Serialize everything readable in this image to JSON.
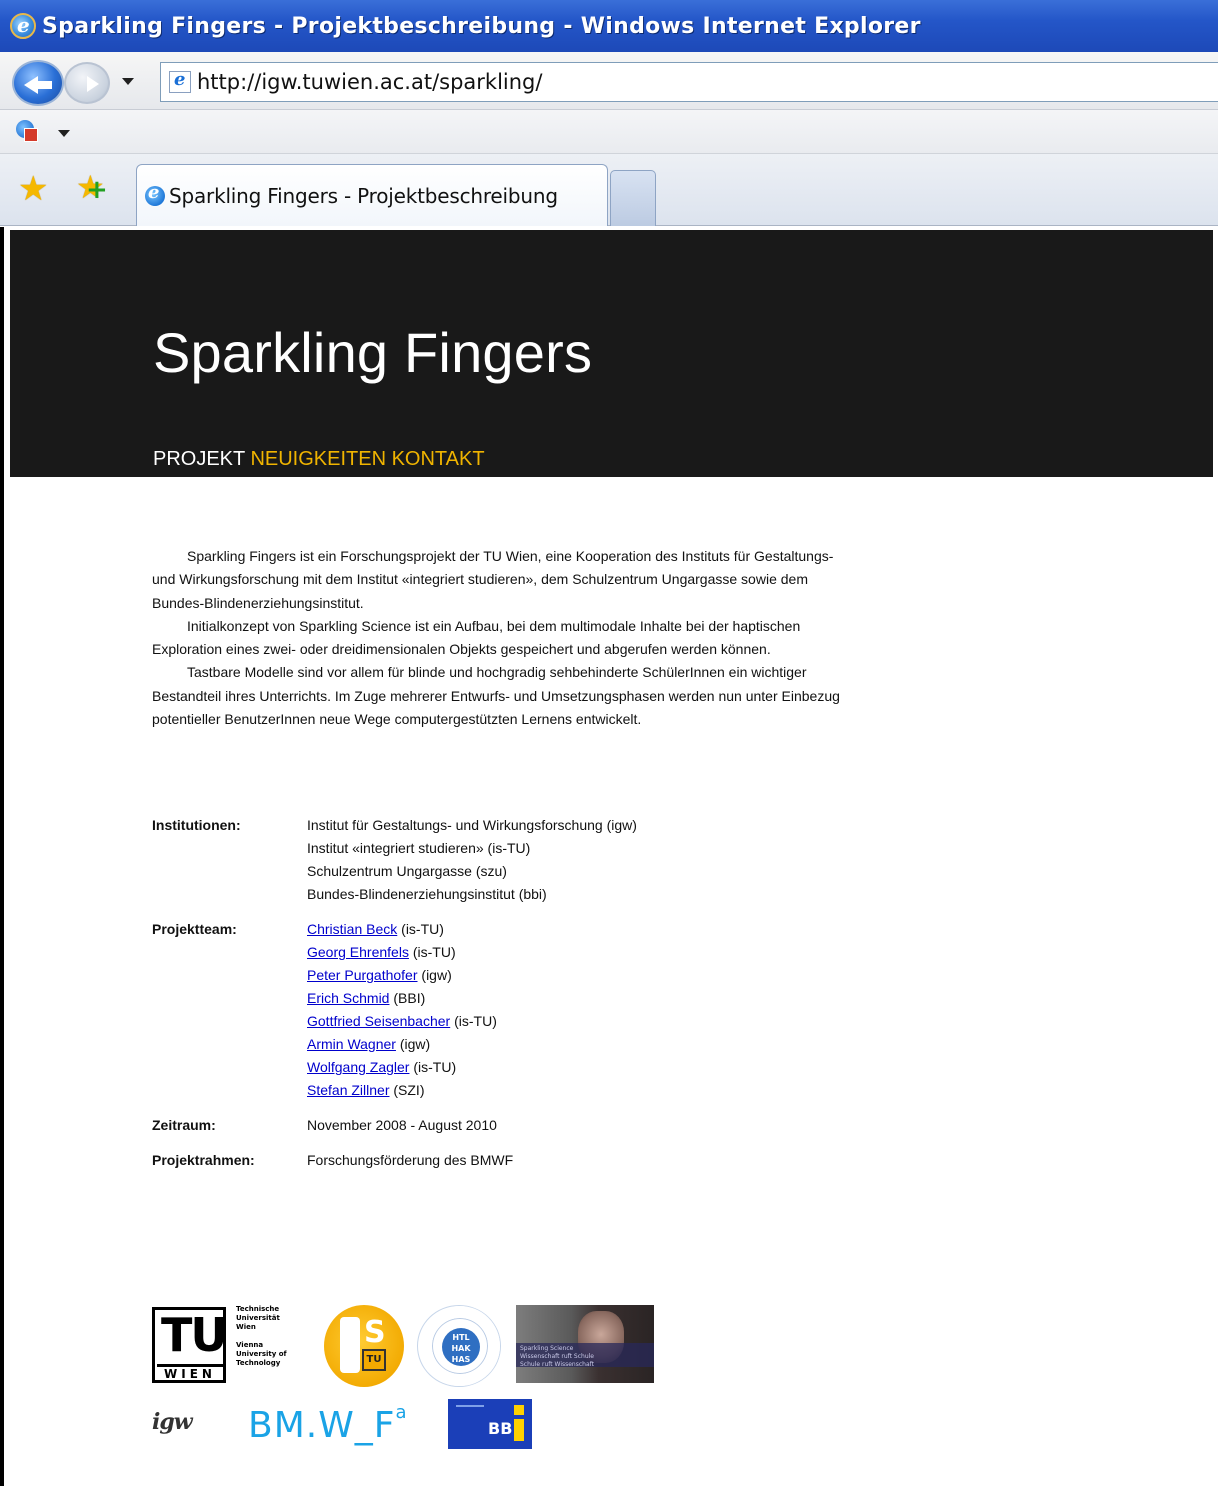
{
  "window": {
    "title": "Sparkling Fingers - Projektbeschreibung - Windows Internet Explorer"
  },
  "toolbar": {
    "address": "http://igw.tuwien.ac.at/sparkling/"
  },
  "tabs": [
    {
      "label": "Sparkling Fingers - Projektbeschreibung"
    }
  ],
  "site": {
    "title": "Sparkling Fingers",
    "nav": {
      "projekt": "PROJEKT",
      "neuigkeiten": "NEUIGKEITEN",
      "kontakt": "KONTAKT"
    },
    "colors": {
      "header_bg": "#191919",
      "nav_active": "#ffffff",
      "nav_link": "#f0b400",
      "link": "#0000cc"
    }
  },
  "intro": {
    "paragraphs": [
      "Sparkling Fingers ist ein Forschungsprojekt der TU Wien, eine Kooperation des Instituts für Gestaltungs- und Wirkungsforschung mit dem Institut «integriert studieren», dem Schulzentrum Ungargasse sowie dem Bundes-Blindenerziehungsinstitut.",
      "Initialkonzept von Sparkling Science ist ein Aufbau, bei dem multimodale Inhalte bei der haptischen Exploration eines zwei- oder dreidimensionalen Objekts gespeichert und abgerufen werden können.",
      "Tastbare Modelle sind vor allem für blinde und hochgradig sehbehinderte SchülerInnen ein wichtiger Bestandteil ihres Unterrichts. Im Zuge mehrerer Entwurfs- und Umsetzungsphasen werden nun unter Einbezug potentieller BenutzerInnen neue Wege computergestützten Lernens entwickelt."
    ]
  },
  "info": {
    "institutionen": {
      "label": "Institutionen:",
      "items": [
        "Institut für Gestaltungs- und Wirkungsforschung (igw)",
        "Institut «integriert studieren» (is-TU)",
        "Schulzentrum Ungargasse (szu)",
        "Bundes-Blindenerziehungsinstitut (bbi)"
      ]
    },
    "projektteam": {
      "label": "Projektteam:",
      "members": [
        {
          "name": "Christian Beck",
          "affiliation": " (is-TU)"
        },
        {
          "name": "Georg Ehrenfels",
          "affiliation": " (is-TU)"
        },
        {
          "name": "Peter Purgathofer",
          "affiliation": " (igw)"
        },
        {
          "name": "Erich Schmid",
          "affiliation": " (BBI)"
        },
        {
          "name": "Gottfried Seisenbacher",
          "affiliation": " (is-TU)"
        },
        {
          "name": "Armin Wagner",
          "affiliation": " (igw)"
        },
        {
          "name": "Wolfgang Zagler",
          "affiliation": " (is-TU)"
        },
        {
          "name": "Stefan Zillner",
          "affiliation": " (SZI)"
        }
      ]
    },
    "zeitraum": {
      "label": "Zeitraum:",
      "value": "November 2008 - August 2010"
    },
    "projektrahmen": {
      "label": "Projektrahmen:",
      "value": "Forschungsförderung des BMWF"
    }
  },
  "logos": {
    "tu": {
      "letters": "TU",
      "wien": "WIEN",
      "text_lines": [
        "Technische",
        "Universität",
        "Wien",
        "",
        "Vienna",
        "University of",
        "Technology"
      ]
    },
    "is": {
      "mark": "S",
      "mini": "TU"
    },
    "szu": {
      "lines": [
        "HTL",
        "HAK",
        "HAS"
      ]
    },
    "sparkling_science": {
      "lines": [
        "Sparkling Science",
        "Wissenschaft ruft Schule",
        "Schule ruft Wissenschaft"
      ]
    },
    "igw": {
      "text": "igw"
    },
    "bmwf": {
      "text": "BM.W_F",
      "sup": "a"
    },
    "bbi": {
      "text": "BB"
    }
  }
}
